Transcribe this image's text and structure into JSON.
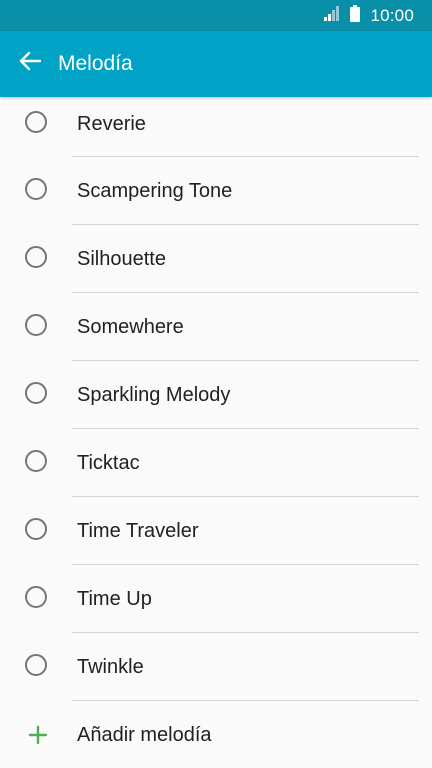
{
  "status_bar": {
    "time": "10:00",
    "signal_icon": "signal-icon",
    "battery_icon": "battery-icon"
  },
  "app_bar": {
    "title": "Melodía",
    "back_icon": "arrow-left-icon",
    "background": "#00a3c5"
  },
  "ringtones": [
    {
      "label": "Reverie",
      "selected": false
    },
    {
      "label": "Scampering Tone",
      "selected": false
    },
    {
      "label": "Silhouette",
      "selected": false
    },
    {
      "label": "Somewhere",
      "selected": false
    },
    {
      "label": "Sparkling Melody",
      "selected": false
    },
    {
      "label": "Ticktac",
      "selected": false
    },
    {
      "label": "Time Traveler",
      "selected": false
    },
    {
      "label": "Time Up",
      "selected": false
    },
    {
      "label": "Twinkle",
      "selected": false
    }
  ],
  "add_item": {
    "label": "Añadir melodía",
    "icon": "plus-icon",
    "icon_color": "#4caf50"
  }
}
